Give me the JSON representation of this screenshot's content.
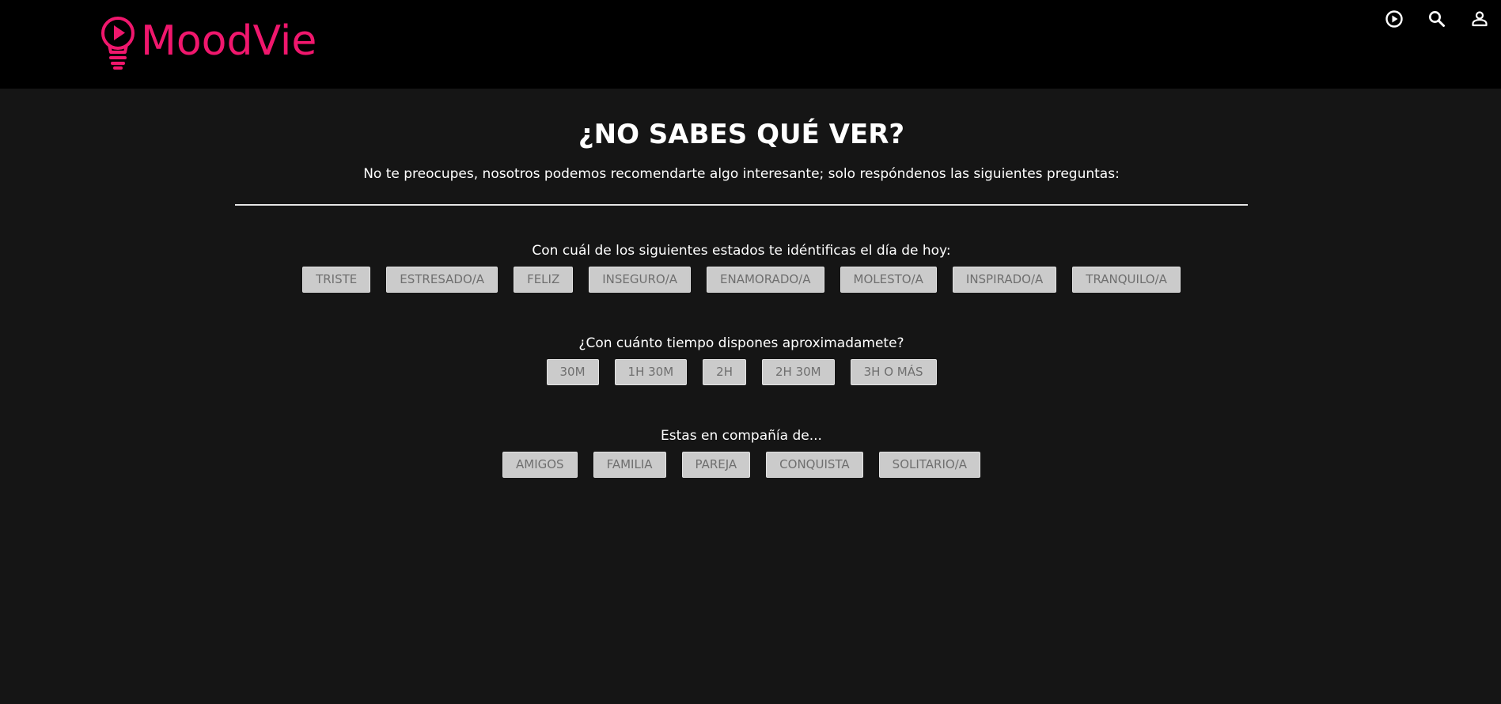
{
  "app": {
    "name": "MoodVie",
    "brand_color": "#f0176d"
  },
  "header": {
    "icons": [
      "play-circle-icon",
      "search-icon",
      "account-icon"
    ]
  },
  "main": {
    "title": "¿NO SABES QUÉ VER?",
    "subtitle": "No te preocupes, nosotros podemos recomendarte algo interesante; solo respóndenos las siguientes preguntas:"
  },
  "questions": [
    {
      "label": "Con cuál de los siguientes estados te idéntificas el día de hoy:",
      "options": [
        "TRISTE",
        "ESTRESADO/A",
        "FELIZ",
        "INSEGURO/A",
        "ENAMORADO/A",
        "MOLESTO/A",
        "INSPIRADO/A",
        "TRANQUILO/A"
      ]
    },
    {
      "label": "¿Con cuánto tiempo dispones aproximadamete?",
      "options": [
        "30M",
        "1H 30M",
        "2H",
        "2H 30M",
        "3H O MÁS"
      ]
    },
    {
      "label": "Estas en compañía de...",
      "options": [
        "AMIGOS",
        "FAMILIA",
        "PAREJA",
        "CONQUISTA",
        "SOLITARIO/A"
      ]
    }
  ]
}
